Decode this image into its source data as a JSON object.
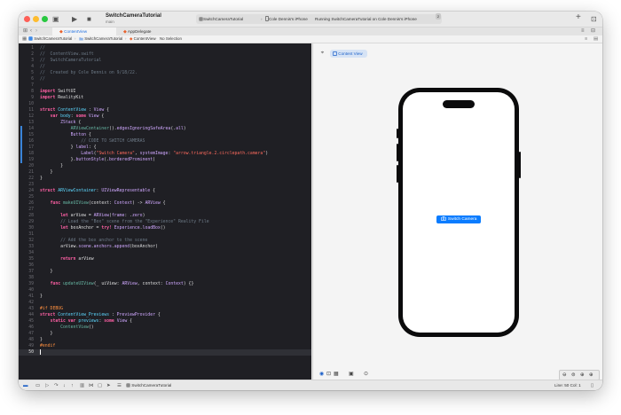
{
  "toolbar": {
    "project_title": "SwitchCameraTutorial",
    "branch": "main",
    "scheme_name": "SwitchCameraTutorial",
    "separator": "›",
    "destination": "Cole Dennis's iPhone",
    "status_text": "Running SwitchCameraTutorial on Cole Dennis's iPhone",
    "status_badge": "2",
    "sidebar_icon": "▣",
    "play_icon": "▶",
    "stop_icon": "■",
    "add_icon": "+",
    "library_icon": "⊡"
  },
  "tabs": [
    {
      "label": "ContentView",
      "active": true
    },
    {
      "label": "AppDelegate",
      "active": false
    }
  ],
  "jumpbar": {
    "crumbs": [
      "SwitchCameraTutorial",
      "SwitchCameraTutorial",
      "ContentView",
      "No Selection"
    ]
  },
  "code": {
    "current_line": 50,
    "changed_lines": [
      14,
      15,
      16,
      17,
      18,
      19
    ]
  },
  "canvas": {
    "preview_label": "Content View",
    "button_label": "Switch Camera",
    "camera_icon": "camera-rotate-icon"
  },
  "statusbar": {
    "scheme_label": "SwitchCameraTutorial",
    "position": "Line: 50  Col: 1"
  },
  "colors": {
    "accent": "#0a7cff",
    "editor_bg": "#1f1f24",
    "keyword": "#fc5fa3",
    "type": "#5dd8ff",
    "string": "#fc6a5d",
    "comment": "#6c7986"
  }
}
